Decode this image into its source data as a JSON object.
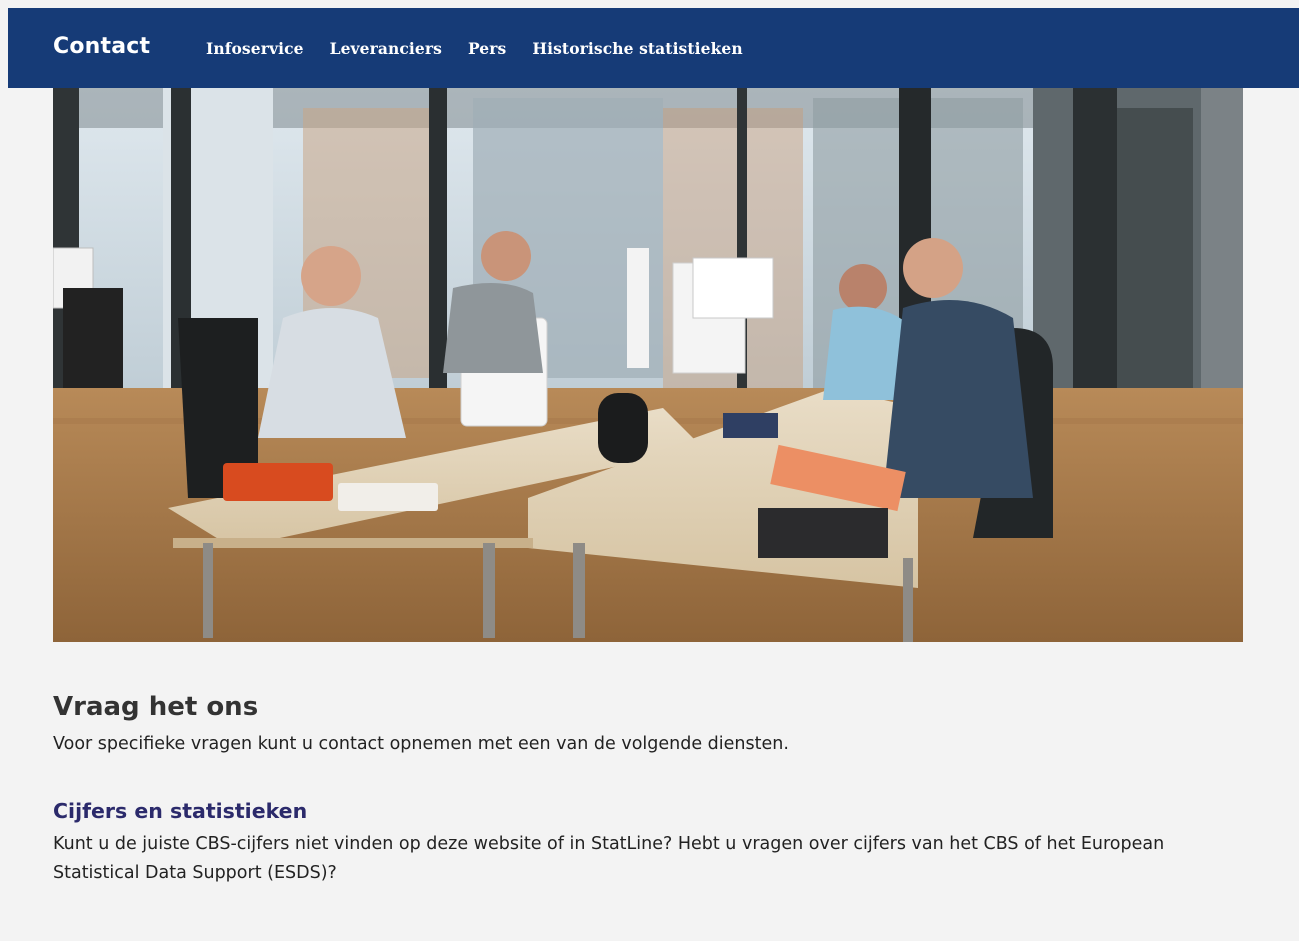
{
  "header": {
    "brand": "Contact",
    "nav": [
      "Infoservice",
      "Leveranciers",
      "Pers",
      "Historische statistieken"
    ]
  },
  "main": {
    "heading": "Vraag het ons",
    "intro": "Voor specifieke vragen kunt u contact opnemen met een van de volgende diensten.",
    "section": {
      "title": "Cijfers en statistieken",
      "text": "Kunt u de juiste CBS-cijfers niet vinden op deze website of in StatLine? Hebt u vragen over cijfers van het CBS of het European Statistical Data Support (ESDS)?"
    }
  },
  "colors": {
    "header_bg": "#163b77",
    "subheading": "#2b2a6b",
    "page_bg": "#f3f3f3"
  }
}
